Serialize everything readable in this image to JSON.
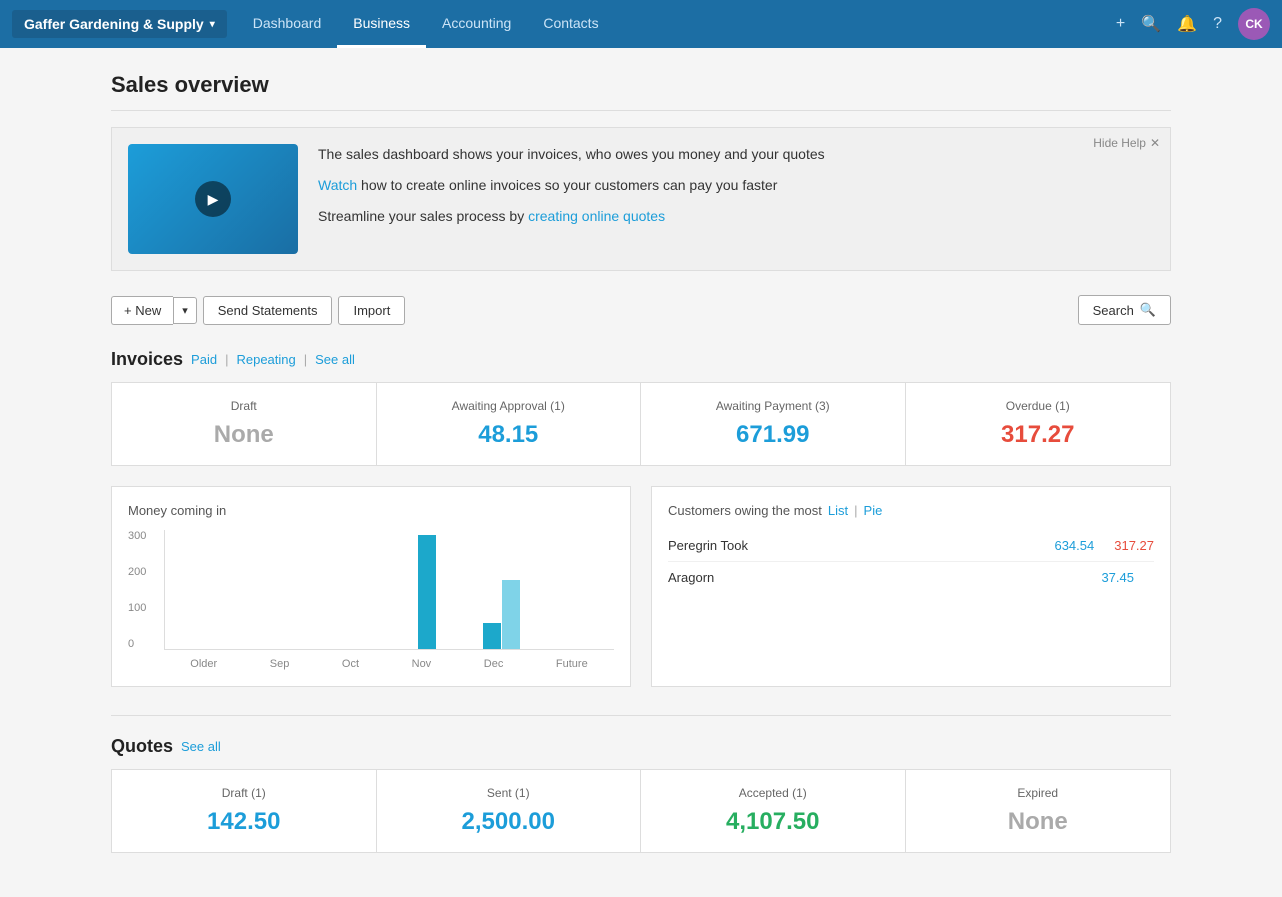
{
  "nav": {
    "brand": "Gaffer Gardening & Supply",
    "links": [
      {
        "label": "Dashboard",
        "active": false
      },
      {
        "label": "Business",
        "active": true
      },
      {
        "label": "Accounting",
        "active": false
      },
      {
        "label": "Contacts",
        "active": false
      }
    ],
    "avatar": "CK"
  },
  "page": {
    "title": "Sales overview"
  },
  "help": {
    "hide_label": "Hide Help",
    "text1": "The sales dashboard shows your invoices, who owes you money and your quotes",
    "text2_prefix": "",
    "text2_link": "Watch",
    "text2_suffix": " how to create online invoices so your customers can pay you faster",
    "text3_prefix": "Streamline your sales process by ",
    "text3_link": "creating online quotes"
  },
  "toolbar": {
    "new_label": "+ New",
    "arrow_label": "▾",
    "send_statements_label": "Send Statements",
    "import_label": "Import",
    "search_label": "Search"
  },
  "invoices": {
    "section_title": "Invoices",
    "links": [
      {
        "label": "Paid"
      },
      {
        "label": "Repeating"
      },
      {
        "label": "See all"
      }
    ],
    "stats": [
      {
        "label": "Draft",
        "value": "None",
        "style": "grey"
      },
      {
        "label": "Awaiting Approval (1)",
        "value": "48.15",
        "style": "blue"
      },
      {
        "label": "Awaiting Payment (3)",
        "value": "671.99",
        "style": "blue"
      },
      {
        "label": "Overdue (1)",
        "value": "317.27",
        "style": "red"
      }
    ]
  },
  "chart": {
    "title": "Money coming in",
    "y_labels": [
      "300",
      "200",
      "100",
      "0"
    ],
    "x_labels": [
      "Older",
      "Sep",
      "Oct",
      "Nov",
      "Dec",
      "Future"
    ],
    "bars": [
      {
        "dark": 0,
        "light": 0
      },
      {
        "dark": 0,
        "light": 0
      },
      {
        "dark": 0,
        "light": 0
      },
      {
        "dark": 85,
        "light": 0
      },
      {
        "dark": 20,
        "light": 55
      },
      {
        "dark": 0,
        "light": 0
      }
    ],
    "max": 300
  },
  "customers": {
    "title": "Customers owing the most",
    "list_label": "List",
    "pie_label": "Pie",
    "rows": [
      {
        "name": "Peregrin Took",
        "owed": "634.54",
        "overdue": "317.27"
      },
      {
        "name": "Aragorn",
        "owed": "37.45",
        "overdue": ""
      }
    ]
  },
  "quotes": {
    "section_title": "Quotes",
    "see_all_label": "See all",
    "stats": [
      {
        "label": "Draft (1)",
        "value": "142.50",
        "style": "blue"
      },
      {
        "label": "Sent (1)",
        "value": "2,500.00",
        "style": "blue"
      },
      {
        "label": "Accepted (1)",
        "value": "4,107.50",
        "style": "green"
      },
      {
        "label": "Expired",
        "value": "None",
        "style": "grey"
      }
    ]
  }
}
